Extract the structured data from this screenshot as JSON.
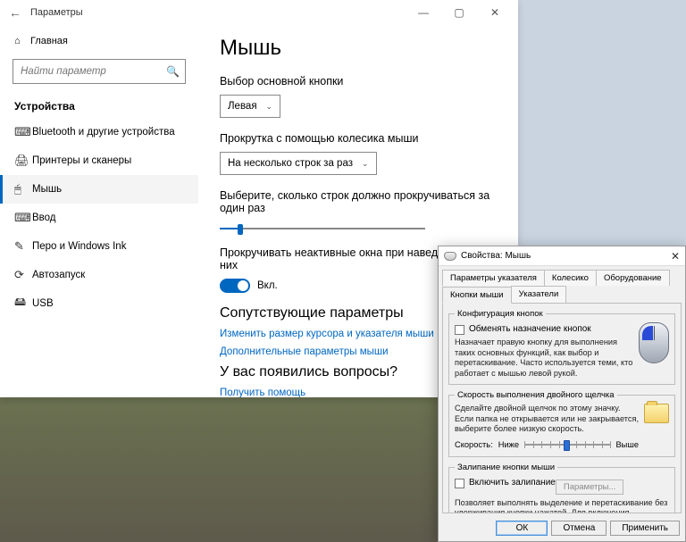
{
  "settings": {
    "window_title": "Параметры",
    "home_label": "Главная",
    "search_placeholder": "Найти параметр",
    "section_title": "Устройства",
    "nav": [
      {
        "icon": "⌨",
        "label": "Bluetooth и другие устройства"
      },
      {
        "icon": "🖨",
        "label": "Принтеры и сканеры"
      },
      {
        "icon": "🖱",
        "label": "Мышь",
        "active": true
      },
      {
        "icon": "⌨",
        "label": "Ввод"
      },
      {
        "icon": "✎",
        "label": "Перо и Windows Ink"
      },
      {
        "icon": "⟳",
        "label": "Автозапуск"
      },
      {
        "icon": "🖴",
        "label": "USB"
      }
    ],
    "content": {
      "heading": "Мышь",
      "primary_btn_label": "Выбор основной кнопки",
      "primary_btn_value": "Левая",
      "scroll_wheel_label": "Прокрутка с помощью колесика мыши",
      "scroll_wheel_value": "На несколько строк за раз",
      "lines_label": "Выберите, сколько строк должно прокручиваться за один раз",
      "lines_slider_percent": 10,
      "inactive_label": "Прокручивать неактивные окна при наведении на них",
      "inactive_state": "Вкл.",
      "related_heading": "Сопутствующие параметры",
      "link_cursor": "Изменить размер курсора и указателя мыши",
      "link_more": "Дополнительные параметры мыши",
      "help_heading": "У вас появились вопросы?",
      "link_help": "Получить помощь"
    }
  },
  "classic": {
    "title": "Свойства: Мышь",
    "tabs_row1": [
      "Параметры указателя",
      "Колесико",
      "Оборудование"
    ],
    "tabs_row2": [
      "Кнопки мыши",
      "Указатели"
    ],
    "active_tab": "Кнопки мыши",
    "group_config": {
      "legend": "Конфигурация кнопок",
      "checkbox_label": "Обменять назначение кнопок",
      "desc": "Назначает правую кнопку для выполнения таких основных функций, как выбор и перетаскивание. Часто используется теми, кто работает с мышью левой рукой."
    },
    "group_speed": {
      "legend": "Скорость выполнения двойного щелчка",
      "desc": "Сделайте двойной щелчок по этому значку. Если папка не открывается или не закрывается, выберите более низкую скорость.",
      "speed_label": "Скорость:",
      "low": "Ниже",
      "high": "Выше",
      "slider_percent": 50
    },
    "group_lock": {
      "legend": "Залипание кнопки мыши",
      "checkbox_label": "Включить залипание",
      "params_btn": "Параметры...",
      "desc": "Позволяет выполнять выделение и перетаскивание без удерживания кнопки нажатой. Для включения ненадолго задержите кнопку мыши в нажатом положении. Для освобождения снова сделайте щелчок."
    },
    "buttons": {
      "ok": "ОК",
      "cancel": "Отмена",
      "apply": "Применить"
    }
  }
}
